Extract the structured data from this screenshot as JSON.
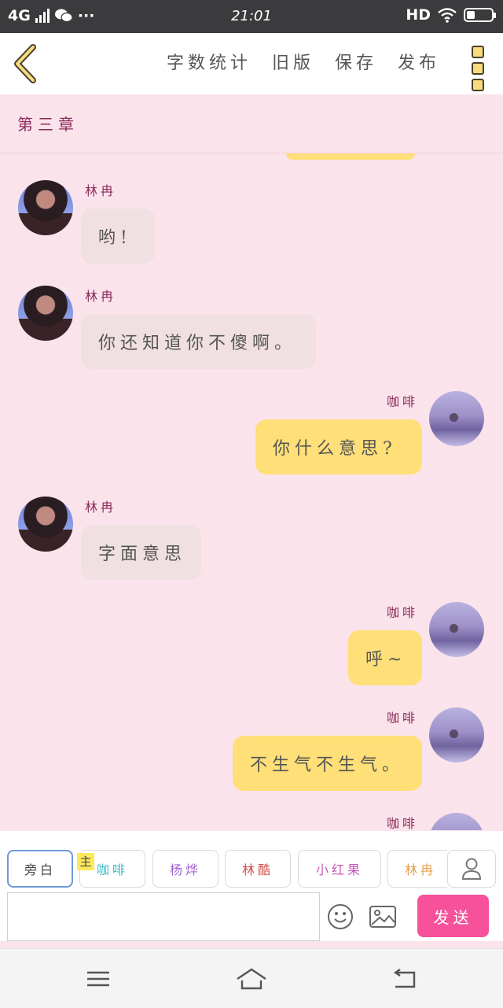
{
  "status_bar": {
    "network": "4G",
    "time": "21:01",
    "hd": "HD",
    "more": "···"
  },
  "toolbar": {
    "word_count": "字数统计",
    "old_version": "旧版",
    "save": "保存",
    "publish": "发布",
    "accent": "#f6dc7e"
  },
  "chapter": {
    "title": "第三章"
  },
  "messages": [
    {
      "sender": "林冉",
      "side": "left",
      "text": "哟!"
    },
    {
      "sender": "林冉",
      "side": "left",
      "text": "你还知道你不傻啊。"
    },
    {
      "sender": "咖啡",
      "side": "right",
      "text": "你什么意思?"
    },
    {
      "sender": "林冉",
      "side": "left",
      "text": "字面意思"
    },
    {
      "sender": "咖啡",
      "side": "right",
      "text": "呼~"
    },
    {
      "sender": "咖啡",
      "side": "right",
      "text": "不生气不生气。"
    },
    {
      "sender": "咖啡",
      "side": "right",
      "text": ""
    }
  ],
  "composer": {
    "roles": [
      {
        "label": "旁白",
        "color": "#444444"
      },
      {
        "label": "咖啡",
        "color": "#3bbcc6"
      },
      {
        "label": "杨烨",
        "color": "#a566cf"
      },
      {
        "label": "林酷",
        "color": "#d4504a"
      },
      {
        "label": "小红果",
        "color": "#c85ab7"
      },
      {
        "label": "林冉",
        "color": "#e8a14a"
      }
    ],
    "main_tag": "主",
    "input_value": "",
    "send_label": "发送",
    "send_color": "#f6519a"
  },
  "icons": {
    "back": "chevron-left-icon",
    "more": "more-vertical-icon",
    "person": "person-icon",
    "emoji": "smiley-icon",
    "image": "image-icon",
    "menu": "menu-icon",
    "home": "home-icon",
    "return": "return-icon"
  }
}
